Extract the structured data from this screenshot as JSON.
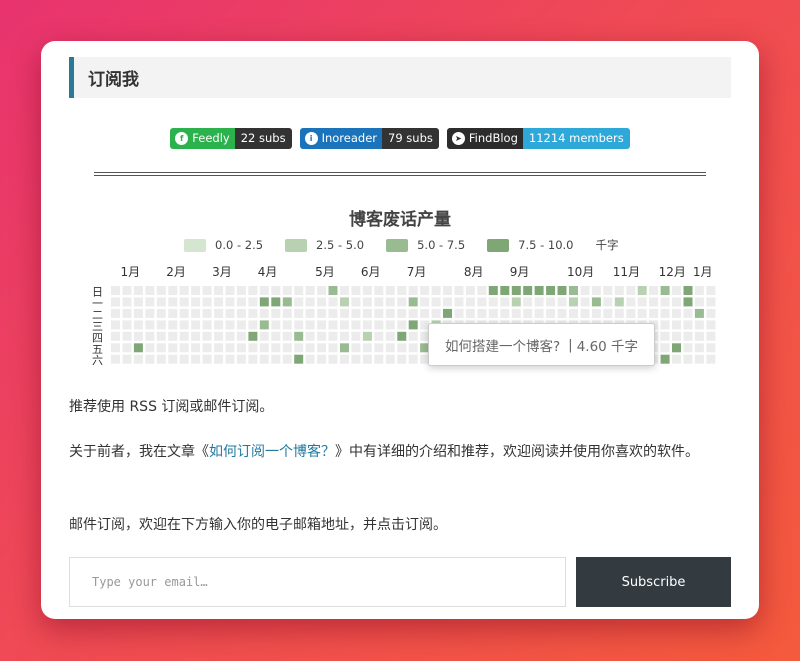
{
  "section": {
    "title": "订阅我"
  },
  "badges": [
    {
      "icon": "feedly-icon",
      "glyph": "f",
      "label": "Feedly",
      "value": "22 subs",
      "left_color": "#2bb24c",
      "right_color": "#333333"
    },
    {
      "icon": "inoreader-icon",
      "glyph": "i",
      "label": "Inoreader",
      "value": "79 subs",
      "left_color": "#1b74bb",
      "right_color": "#333333"
    },
    {
      "icon": "telegram-icon",
      "glyph": "➤",
      "label": "FindBlog",
      "value": "11214 members",
      "left_color": "#2c2c2c",
      "right_color": "#2ea8d9"
    }
  ],
  "chart_data": {
    "type": "heatmap",
    "title": "博客废话产量",
    "legend": [
      {
        "label": "0.0 - 2.5",
        "color": "#d4e5d0"
      },
      {
        "label": "2.5 - 5.0",
        "color": "#b7d1b1"
      },
      {
        "label": "5.0 - 7.5",
        "color": "#99bb91"
      },
      {
        "label": "7.5 - 10.0",
        "color": "#7ea775"
      }
    ],
    "unit": "千字",
    "empty_color": "#ececec",
    "months": [
      "1月",
      "2月",
      "3月",
      "4月",
      "5月",
      "6月",
      "7月",
      "8月",
      "9月",
      "10月",
      "11月",
      "12月",
      "1月"
    ],
    "month_weeks": [
      1,
      5,
      9,
      13,
      18,
      22,
      26,
      31,
      35,
      40,
      44,
      48,
      51
    ],
    "weekdays": [
      "日",
      "一",
      "二",
      "三",
      "四",
      "五",
      "六"
    ],
    "weeks": 53,
    "cells": [
      {
        "w": 19,
        "d": 0,
        "v": 3
      },
      {
        "w": 33,
        "d": 0,
        "v": 6
      },
      {
        "w": 34,
        "d": 0,
        "v": 4
      },
      {
        "w": 35,
        "d": 0,
        "v": 5
      },
      {
        "w": 36,
        "d": 0,
        "v": 4
      },
      {
        "w": 37,
        "d": 0,
        "v": 5
      },
      {
        "w": 38,
        "d": 0,
        "v": 4
      },
      {
        "w": 39,
        "d": 0,
        "v": 4
      },
      {
        "w": 40,
        "d": 0,
        "v": 3
      },
      {
        "w": 46,
        "d": 0,
        "v": 2
      },
      {
        "w": 48,
        "d": 0,
        "v": 3
      },
      {
        "w": 50,
        "d": 0,
        "v": 5
      },
      {
        "w": 13,
        "d": 1,
        "v": 5
      },
      {
        "w": 14,
        "d": 1,
        "v": 4
      },
      {
        "w": 15,
        "d": 1,
        "v": 3
      },
      {
        "w": 20,
        "d": 1,
        "v": 2
      },
      {
        "w": 26,
        "d": 1,
        "v": 3
      },
      {
        "w": 35,
        "d": 1,
        "v": 2
      },
      {
        "w": 40,
        "d": 1,
        "v": 2
      },
      {
        "w": 42,
        "d": 1,
        "v": 3
      },
      {
        "w": 44,
        "d": 1,
        "v": 2
      },
      {
        "w": 50,
        "d": 1,
        "v": 4
      },
      {
        "w": 29,
        "d": 2,
        "v": 4
      },
      {
        "w": 51,
        "d": 2,
        "v": 3
      },
      {
        "w": 13,
        "d": 3,
        "v": 3
      },
      {
        "w": 26,
        "d": 3,
        "v": 4
      },
      {
        "w": 28,
        "d": 3,
        "v": 2
      },
      {
        "w": 12,
        "d": 4,
        "v": 5
      },
      {
        "w": 16,
        "d": 4,
        "v": 3
      },
      {
        "w": 22,
        "d": 4,
        "v": 2
      },
      {
        "w": 25,
        "d": 4,
        "v": 4
      },
      {
        "w": 2,
        "d": 5,
        "v": 4
      },
      {
        "w": 20,
        "d": 5,
        "v": 3
      },
      {
        "w": 27,
        "d": 5,
        "v": 3
      },
      {
        "w": 49,
        "d": 5,
        "v": 4
      },
      {
        "w": 16,
        "d": 6,
        "v": 4
      },
      {
        "w": 38,
        "d": 6,
        "v": 3
      },
      {
        "w": 43,
        "d": 6,
        "v": 2
      },
      {
        "w": 48,
        "d": 6,
        "v": 5
      }
    ]
  },
  "tooltip": {
    "title": "如何搭建一个博客?",
    "value": "4.60 千字"
  },
  "content": {
    "p1": "推荐使用 RSS 订阅或邮件订阅。",
    "p2_before": "关于前者，我在文章《",
    "p2_link": "如何订阅一个博客？",
    "p2_after": "》中有详细的介绍和推荐，欢迎阅读并使用你喜欢的软件。",
    "p3": "邮件订阅，欢迎在下方输入你的电子邮箱地址，并点击订阅。"
  },
  "form": {
    "email_placeholder": "Type your email…",
    "subscribe_label": "Subscribe"
  }
}
